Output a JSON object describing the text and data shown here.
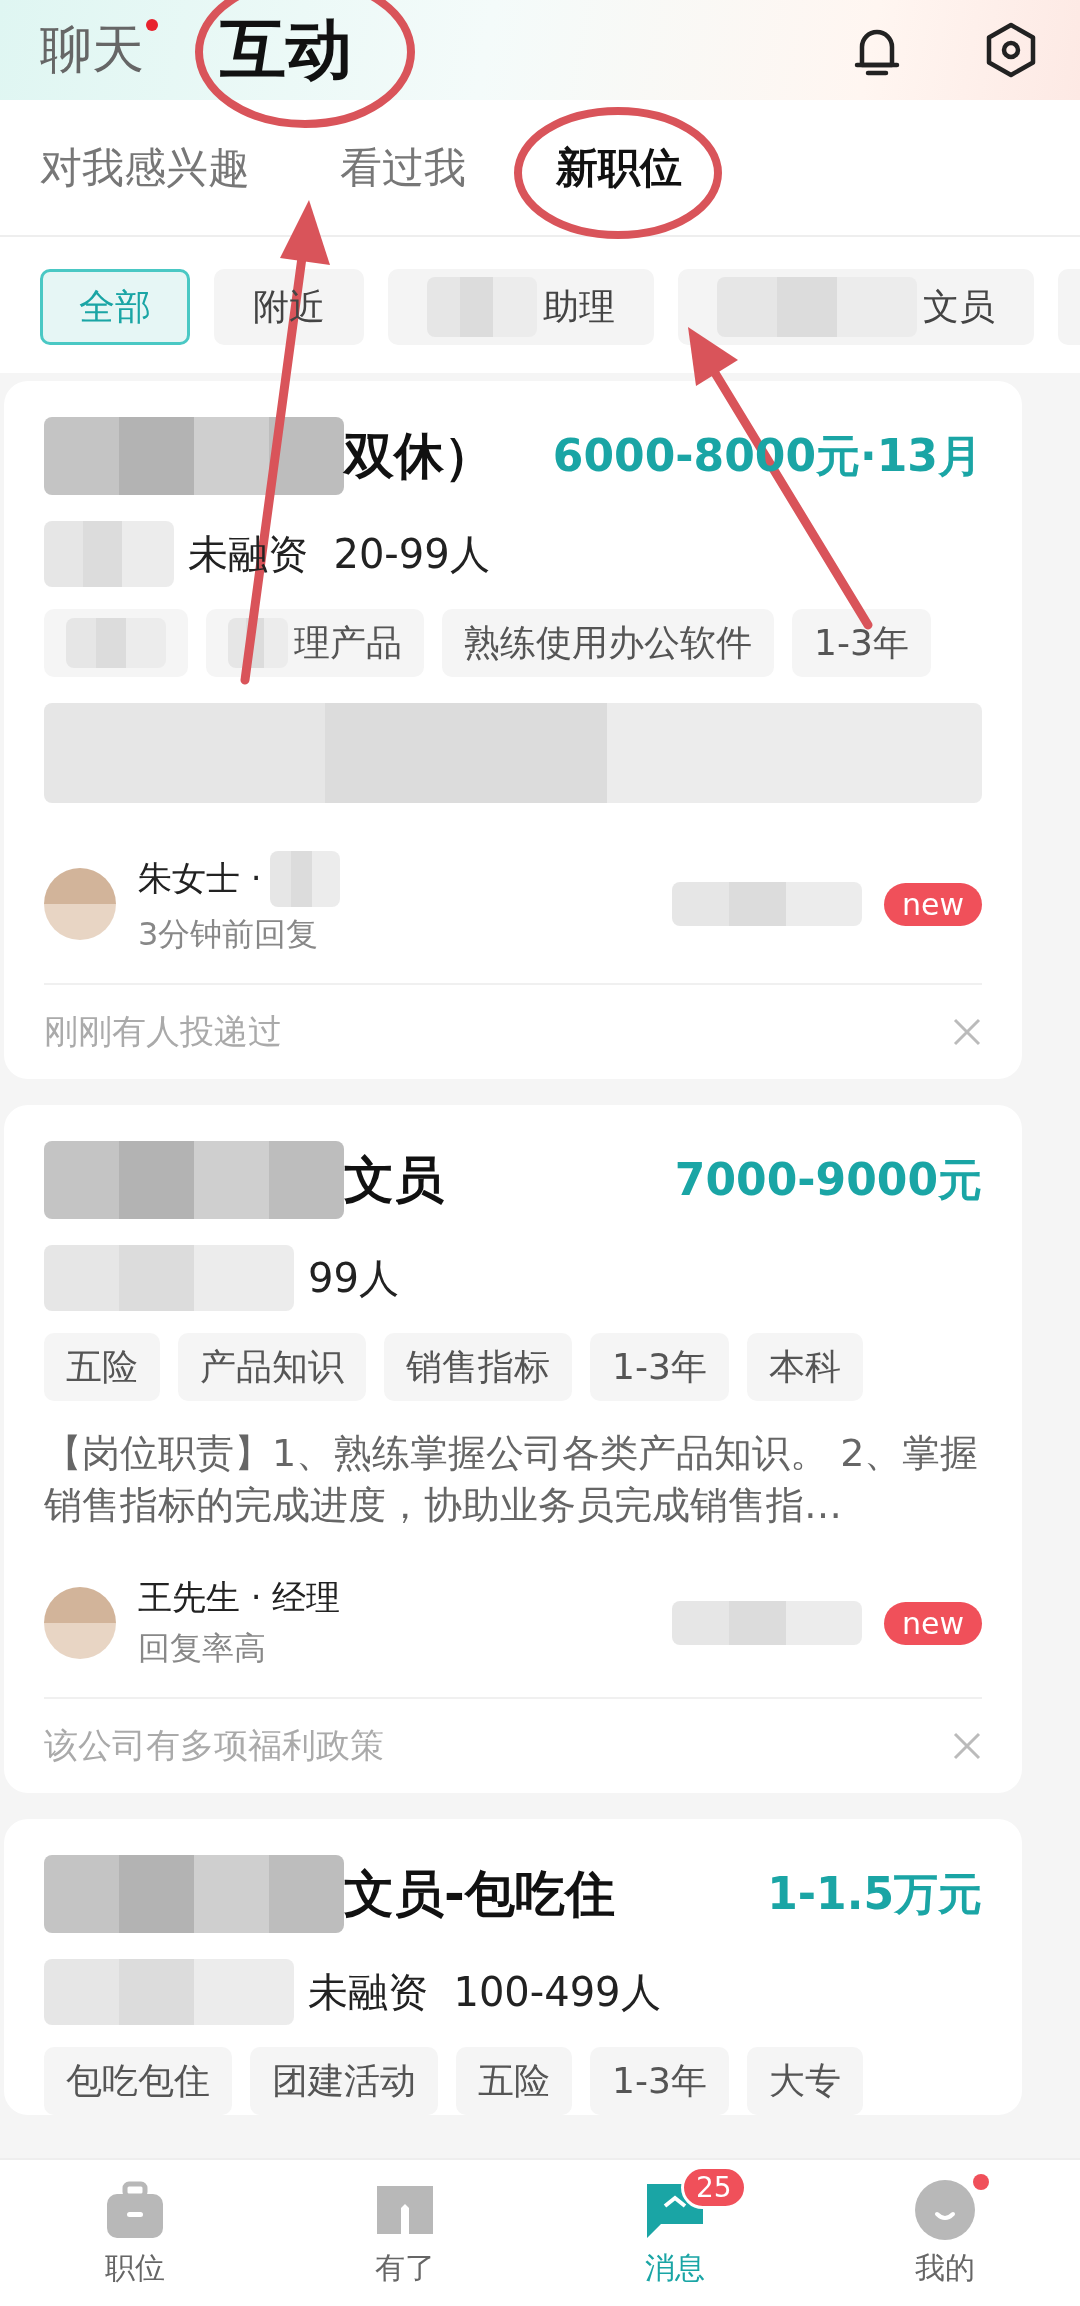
{
  "header": {
    "tabs": [
      {
        "label": "聊天",
        "selected": false,
        "dot": true
      },
      {
        "label": "互动",
        "selected": true,
        "dot": false
      }
    ]
  },
  "subtabs": [
    {
      "label": "对我感兴趣",
      "selected": false
    },
    {
      "label": "看过我",
      "selected": false
    },
    {
      "label": "新职位",
      "selected": true
    }
  ],
  "filters": [
    {
      "label": "全部",
      "selected": true,
      "blurred": false
    },
    {
      "label": "附近",
      "selected": false,
      "blurred": false
    },
    {
      "label": "助理",
      "selected": false,
      "blurred": true
    },
    {
      "label": "文员",
      "selected": false,
      "blurred": true
    }
  ],
  "cards": [
    {
      "title": "双休）",
      "salary": "6000-8000元·13月",
      "company": "未融资  20-99人",
      "tags": [
        {
          "blurred": true
        },
        {
          "label": "理产品",
          "blurred": true
        },
        {
          "label": "熟练使用办公软件",
          "blurred": false
        },
        {
          "label": "1-3年",
          "blurred": false
        }
      ],
      "description_blurred": true,
      "recruiter": {
        "name": "朱女士 ·",
        "role_blurred": true,
        "status": "3分钟前回复"
      },
      "badge": "new",
      "footer": "刚刚有人投递过"
    },
    {
      "title": "文员",
      "salary": "7000-9000元",
      "company": "99人",
      "tags": [
        {
          "label": "五险",
          "blurred": false
        },
        {
          "label": "产品知识",
          "blurred": false
        },
        {
          "label": "销售指标",
          "blurred": false
        },
        {
          "label": "1-3年",
          "blurred": false
        },
        {
          "label": "本科",
          "blurred": false
        }
      ],
      "description": "【岗位职责】1、熟练掌握公司各类产品知识。 2、掌握销售指标的完成进度，协助业务员完成销售指…",
      "recruiter": {
        "name": "王先生 · 经理",
        "status": "回复率高"
      },
      "badge": "new",
      "footer": "该公司有多项福利政策"
    },
    {
      "title": "文员-包吃住",
      "salary": "1-1.5万元",
      "company": "未融资  100-499人",
      "tags": [
        {
          "label": "包吃包住",
          "blurred": false
        },
        {
          "label": "团建活动",
          "blurred": false
        },
        {
          "label": "五险",
          "blurred": false
        },
        {
          "label": "1-3年",
          "blurred": false
        },
        {
          "label": "大专",
          "blurred": false
        }
      ]
    }
  ],
  "nav": [
    {
      "kind": "jobs",
      "label": "职位",
      "selected": false
    },
    {
      "kind": "feed",
      "label": "有了",
      "selected": false
    },
    {
      "kind": "messages",
      "label": "消息",
      "selected": true,
      "badge": "25"
    },
    {
      "kind": "me",
      "label": "我的",
      "selected": false,
      "dot": true
    }
  ]
}
